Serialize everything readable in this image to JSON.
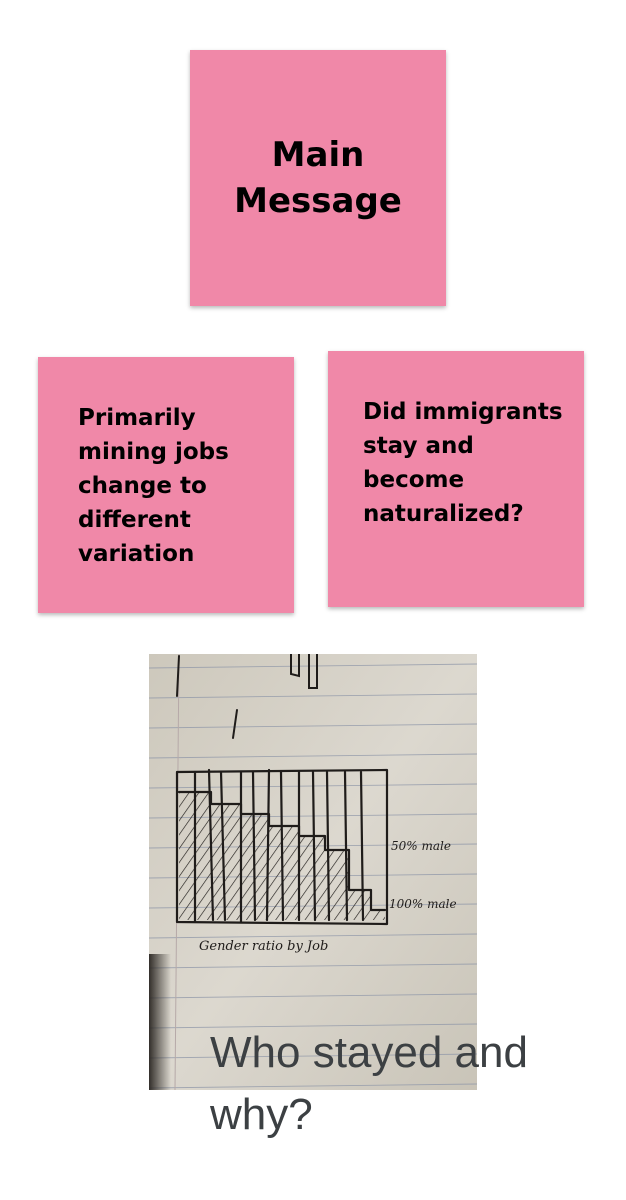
{
  "notes": {
    "main": {
      "line1": "Main",
      "line2": "Message"
    },
    "left": {
      "text": "Primarily mining jobs change to different variation"
    },
    "right": {
      "text": "Did immigrants stay and become naturalized?"
    }
  },
  "sketch": {
    "label_top": "50% male",
    "label_bottom": "100% male",
    "caption": "Gender ratio by Job"
  },
  "caption": {
    "text": "Who stayed and why?"
  },
  "colors": {
    "sticky": "#f088a8",
    "caption_text": "#3c4043",
    "paper": "#d8d4ca"
  }
}
